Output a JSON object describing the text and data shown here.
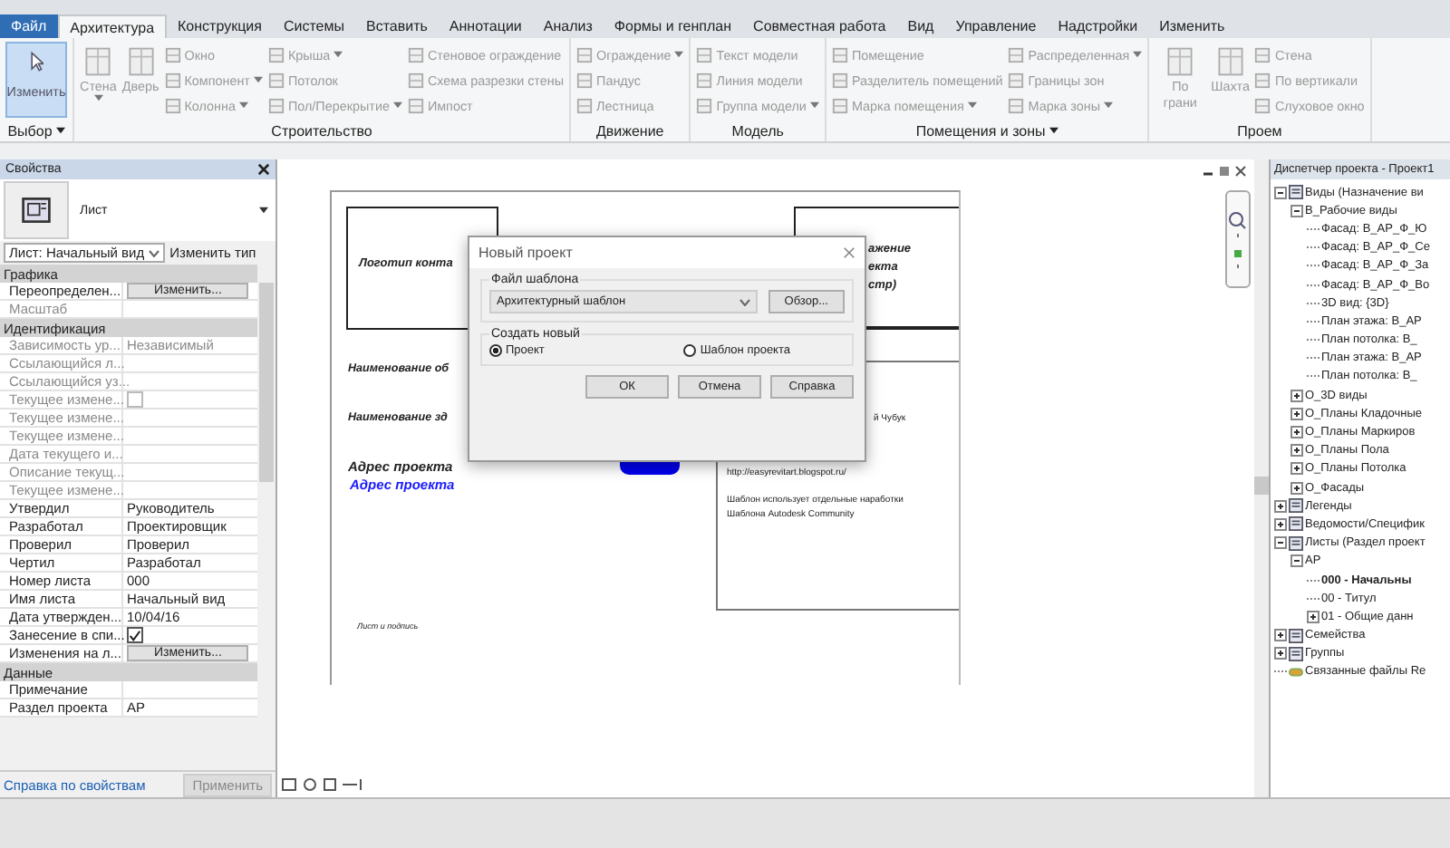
{
  "tabs": [
    {
      "label": "Файл",
      "selected": false
    },
    {
      "label": "Архитектура",
      "selected": true
    },
    {
      "label": "Конструкция",
      "selected": false
    },
    {
      "label": "Системы",
      "selected": false
    },
    {
      "label": "Вставить",
      "selected": false
    },
    {
      "label": "Аннотации",
      "selected": false
    },
    {
      "label": "Анализ",
      "selected": false
    },
    {
      "label": "Формы и генплан",
      "selected": false
    },
    {
      "label": "Совместная работа",
      "selected": false
    },
    {
      "label": "Вид",
      "selected": false
    },
    {
      "label": "Управление",
      "selected": false
    },
    {
      "label": "Надстройки",
      "selected": false
    },
    {
      "label": "Изменить",
      "selected": false
    }
  ],
  "ribbon": [
    {
      "title": "Выбор",
      "menu": true,
      "tools": [
        {
          "label": "Изменить",
          "kind": "mode",
          "disabled": false,
          "dropdown": false
        }
      ]
    },
    {
      "title": "Строительство",
      "menu": false,
      "tools": [
        {
          "label": "Стена",
          "kind": "large",
          "disabled": true,
          "dropdown": true
        },
        {
          "label": "Дверь",
          "kind": "large",
          "disabled": true,
          "dropdown": false
        },
        {
          "label": "Окно",
          "kind": "small",
          "disabled": true,
          "dropdown": false
        },
        {
          "label": "Компонент",
          "kind": "small",
          "disabled": true,
          "dropdown": true
        },
        {
          "label": "Колонна",
          "kind": "small",
          "disabled": true,
          "dropdown": true
        },
        {
          "label": "Крыша",
          "kind": "small",
          "disabled": true,
          "dropdown": true
        },
        {
          "label": "Потолок",
          "kind": "small",
          "disabled": true,
          "dropdown": false
        },
        {
          "label": "Пол/Перекрытие",
          "kind": "small",
          "disabled": true,
          "dropdown": true
        },
        {
          "label": "Стеновое ограждение",
          "kind": "small",
          "disabled": true,
          "dropdown": false
        },
        {
          "label": "Схема разрезки стены",
          "kind": "small",
          "disabled": true,
          "dropdown": false
        },
        {
          "label": "Импост",
          "kind": "small",
          "disabled": true,
          "dropdown": false
        }
      ]
    },
    {
      "title": "Движение",
      "menu": false,
      "tools": [
        {
          "label": "Ограждение",
          "kind": "small",
          "disabled": true,
          "dropdown": true
        },
        {
          "label": "Пандус",
          "kind": "small",
          "disabled": true,
          "dropdown": false
        },
        {
          "label": "Лестница",
          "kind": "small",
          "disabled": true,
          "dropdown": false
        }
      ]
    },
    {
      "title": "Модель",
      "menu": false,
      "tools": [
        {
          "label": "Текст модели",
          "kind": "small",
          "disabled": true,
          "dropdown": false
        },
        {
          "label": "Линия модели",
          "kind": "small",
          "disabled": true,
          "dropdown": false
        },
        {
          "label": "Группа модели",
          "kind": "small",
          "disabled": true,
          "dropdown": true
        }
      ]
    },
    {
      "title": "Помещения и зоны",
      "menu": true,
      "tools": [
        {
          "label": "Помещение",
          "kind": "small",
          "disabled": true,
          "dropdown": false
        },
        {
          "label": "Разделитель помещений",
          "kind": "small",
          "disabled": true,
          "dropdown": false
        },
        {
          "label": "Марка помещения",
          "kind": "small",
          "disabled": true,
          "dropdown": true
        },
        {
          "label": "Распределенная",
          "kind": "small",
          "disabled": true,
          "dropdown": true
        },
        {
          "label": "Границы зон",
          "kind": "small",
          "disabled": true,
          "dropdown": false
        },
        {
          "label": "Марка зоны",
          "kind": "small",
          "disabled": true,
          "dropdown": true
        }
      ]
    },
    {
      "title": "Проем",
      "menu": false,
      "tools": [
        {
          "label": "По грани",
          "kind": "large",
          "disabled": true,
          "dropdown": false
        },
        {
          "label": "Шахта",
          "kind": "large",
          "disabled": true,
          "dropdown": false
        },
        {
          "label": "Стена",
          "kind": "small",
          "disabled": true,
          "dropdown": false
        },
        {
          "label": "По вертикали",
          "kind": "small",
          "disabled": true,
          "dropdown": false
        },
        {
          "label": "Слуховое окно",
          "kind": "small",
          "disabled": true,
          "dropdown": false
        }
      ]
    }
  ],
  "properties": {
    "title": "Свойства",
    "family": "Лист",
    "type_selector": "Лист: Начальный вид",
    "edit_type": "Изменить тип",
    "groups": [
      {
        "title": "Графика",
        "rows": [
          {
            "label": "Переопределен...",
            "value": "Изменить...",
            "kind": "button",
            "disabled": false
          },
          {
            "label": "Масштаб",
            "value": "",
            "kind": "text",
            "disabled": true
          }
        ]
      },
      {
        "title": "Идентификация",
        "rows": [
          {
            "label": "Зависимость ур...",
            "value": "Независимый",
            "kind": "text",
            "disabled": true
          },
          {
            "label": "Ссылающийся л...",
            "value": "",
            "kind": "text",
            "disabled": true
          },
          {
            "label": "Ссылающийся уз...",
            "value": "",
            "kind": "text",
            "disabled": true
          },
          {
            "label": "Текущее измене...",
            "kind": "checkbox",
            "checked": false,
            "disabled": true
          },
          {
            "label": "Текущее измене...",
            "value": "",
            "kind": "text",
            "disabled": true
          },
          {
            "label": "Текущее измене...",
            "value": "",
            "kind": "text",
            "disabled": true
          },
          {
            "label": "Дата текущего и...",
            "value": "",
            "kind": "text",
            "disabled": true
          },
          {
            "label": "Описание текущ...",
            "value": "",
            "kind": "text",
            "disabled": true
          },
          {
            "label": "Текущее измене...",
            "value": "",
            "kind": "text",
            "disabled": true
          },
          {
            "label": "Утвердил",
            "value": "Руководитель",
            "kind": "text",
            "disabled": false
          },
          {
            "label": "Разработал",
            "value": "Проектировщик",
            "kind": "text",
            "disabled": false
          },
          {
            "label": "Проверил",
            "value": "Проверил",
            "kind": "text",
            "disabled": false
          },
          {
            "label": "Чертил",
            "value": "Разработал",
            "kind": "text",
            "disabled": false
          },
          {
            "label": "Номер листа",
            "value": "000",
            "kind": "text",
            "disabled": false
          },
          {
            "label": "Имя листа",
            "value": "Начальный вид",
            "kind": "text",
            "disabled": false
          },
          {
            "label": "Дата утвержден...",
            "value": "10/04/16",
            "kind": "text",
            "disabled": false
          },
          {
            "label": "Занесение в спи...",
            "kind": "checkbox",
            "checked": true,
            "disabled": false
          },
          {
            "label": "Изменения на л...",
            "value": "Изменить...",
            "kind": "button",
            "disabled": false
          }
        ]
      },
      {
        "title": "Данные",
        "rows": [
          {
            "label": "Примечание",
            "value": "",
            "kind": "text",
            "disabled": false
          },
          {
            "label": "Раздел проекта",
            "value": "АР",
            "kind": "text",
            "disabled": false
          }
        ]
      }
    ],
    "help_link": "Справка по свойствам",
    "apply": "Применить"
  },
  "sheet": {
    "logo_box": "Логотип конта",
    "image_box": [
      "ажение",
      "екта",
      "стр)"
    ],
    "object_name": "Наименование об",
    "building_name": "Наименование зд",
    "address": "Адрес проекта",
    "address_link": "Адрес проекта",
    "signature": "Лист и подпись",
    "author": "й Чубук",
    "url": "http://easyrevitart.blogspot.ru/",
    "note": [
      "Шаблон использует отдельные наработки",
      "Шаблона Autodesk Community"
    ]
  },
  "dialog": {
    "title": "Новый проект",
    "template_group": "Файл шаблона",
    "template": "Архитектурный шаблон",
    "browse": "Обзор...",
    "create_group": "Создать новый",
    "options": [
      {
        "label": "Проект",
        "selected": true
      },
      {
        "label": "Шаблон проекта",
        "selected": false
      }
    ],
    "buttons": [
      "ОК",
      "Отмена",
      "Справка"
    ]
  },
  "browser": {
    "title": "Диспетчер проекта - Проект1",
    "tree": [
      {
        "label": "Виды (Назначение ви",
        "kind": "category",
        "expanded": true,
        "children": [
          {
            "label": "В_Рабочие виды",
            "kind": "folder",
            "expanded": true,
            "children": [
              {
                "label": "Фасад: В_АР_Ф_Ю",
                "kind": "leaf"
              },
              {
                "label": "Фасад: В_АР_Ф_Се",
                "kind": "leaf"
              },
              {
                "label": "Фасад: В_АР_Ф_За",
                "kind": "leaf"
              },
              {
                "label": "Фасад: В_АР_Ф_Во",
                "kind": "leaf"
              },
              {
                "label": "3D вид: {3D}",
                "kind": "leaf"
              },
              {
                "label": "План этажа: В_АР",
                "kind": "leaf"
              },
              {
                "label": "План потолка: В_",
                "kind": "leaf"
              },
              {
                "label": "План этажа: В_АР",
                "kind": "leaf"
              },
              {
                "label": "План потолка: В_",
                "kind": "leaf"
              }
            ]
          },
          {
            "label": "О_3D виды",
            "kind": "folder",
            "expanded": false
          },
          {
            "label": "О_Планы Кладочные",
            "kind": "folder",
            "expanded": false
          },
          {
            "label": "О_Планы Маркиров",
            "kind": "folder",
            "expanded": false
          },
          {
            "label": "О_Планы Пола",
            "kind": "folder",
            "expanded": false
          },
          {
            "label": "О_Планы Потолка",
            "kind": "folder",
            "expanded": false
          },
          {
            "label": "О_Фасады",
            "kind": "folder",
            "expanded": false
          }
        ]
      },
      {
        "label": "Легенды",
        "kind": "category",
        "expanded": false
      },
      {
        "label": "Ведомости/Специфик",
        "kind": "category",
        "expanded": false
      },
      {
        "label": "Листы (Раздел проект",
        "kind": "category",
        "expanded": true,
        "children": [
          {
            "label": "АР",
            "kind": "folder",
            "expanded": true,
            "children": [
              {
                "label": "000 - Начальны",
                "kind": "leaf",
                "current": true
              },
              {
                "label": "00 - Титул",
                "kind": "leaf",
                "current": false
              },
              {
                "label": "01 - Общие данн",
                "kind": "folder",
                "expanded": false,
                "current": false
              }
            ]
          }
        ]
      },
      {
        "label": "Семейства",
        "kind": "category",
        "expanded": false
      },
      {
        "label": "Группы",
        "kind": "category",
        "expanded": false
      },
      {
        "label": "Связанные файлы Re",
        "kind": "link"
      }
    ]
  }
}
